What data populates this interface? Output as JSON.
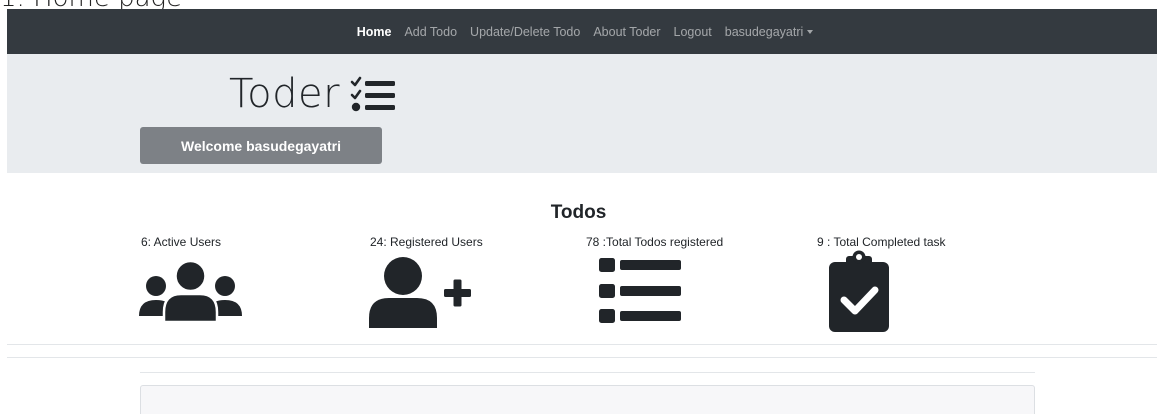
{
  "document": {
    "heading": "1. Home page"
  },
  "navbar": {
    "items": [
      "Home",
      "Add Todo",
      "Update/Delete Todo",
      "About Toder",
      "Logout"
    ],
    "user": "basudegayatri"
  },
  "jumbotron": {
    "brand": "Toder",
    "welcome": "Welcome basudegayatri"
  },
  "main": {
    "title": "Todos",
    "stats": [
      {
        "label": "6: Active Users",
        "icon": "users-icon"
      },
      {
        "label": "24: Registered Users",
        "icon": "user-plus-icon"
      },
      {
        "label": "78 :Total Todos registered",
        "icon": "list-icon"
      },
      {
        "label": "9 : Total Completed task",
        "icon": "clipboard-check-icon"
      }
    ]
  },
  "colors": {
    "navbar_bg": "#343a40",
    "jumbotron_bg": "#e9ecef",
    "welcome_btn": "#7d8186",
    "icon": "#212529"
  }
}
